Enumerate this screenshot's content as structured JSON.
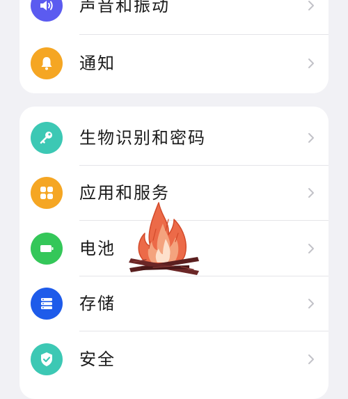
{
  "settings_group_1": {
    "items": [
      {
        "label": "声音和振动",
        "icon": "speaker-icon",
        "color": "#5b5bf0"
      },
      {
        "label": "通知",
        "icon": "bell-icon",
        "color": "#f5a623"
      }
    ]
  },
  "settings_group_2": {
    "items": [
      {
        "label": "生物识别和密码",
        "icon": "key-icon",
        "color": "#3cc8b4"
      },
      {
        "label": "应用和服务",
        "icon": "apps-grid-icon",
        "color": "#f5a623"
      },
      {
        "label": "电池",
        "icon": "battery-icon",
        "color": "#34c759"
      },
      {
        "label": "存储",
        "icon": "storage-icon",
        "color": "#1e5bea"
      },
      {
        "label": "安全",
        "icon": "shield-check-icon",
        "color": "#3cc8b4"
      }
    ]
  },
  "overlay": {
    "icon": "campfire-icon",
    "flame_color": "#e8583a",
    "wood_color": "#5a1f1f"
  },
  "colors": {
    "background": "#f1f1f5",
    "card": "#ffffff",
    "chevron": "#c2c2c8",
    "divider": "#e4e4e8"
  }
}
